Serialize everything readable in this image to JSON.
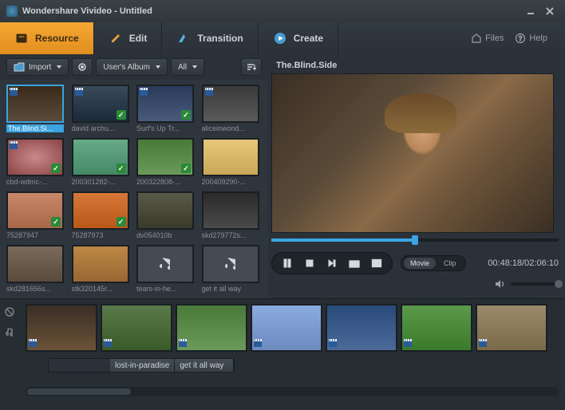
{
  "window": {
    "title": "Wondershare Vivideo - Untitled"
  },
  "tabs": {
    "resource": "Resource",
    "edit": "Edit",
    "transition": "Transition",
    "create": "Create"
  },
  "header_links": {
    "files": "Files",
    "help": "Help"
  },
  "toolbar": {
    "import": "Import",
    "album": "User's Album",
    "filter": "All"
  },
  "thumbs": [
    {
      "label": "The.Blind.Si...",
      "selected": true,
      "video": true,
      "check": false,
      "bg": "bg0"
    },
    {
      "label": "david archu...",
      "selected": false,
      "video": true,
      "check": true,
      "bg": "bg1"
    },
    {
      "label": "Surf's Up Tr...",
      "selected": false,
      "video": true,
      "check": true,
      "bg": "bg2"
    },
    {
      "label": "aliceinwond...",
      "selected": false,
      "video": true,
      "check": false,
      "bg": "bg3"
    },
    {
      "label": "cbd-wdmc-...",
      "selected": false,
      "video": true,
      "check": true,
      "bg": "bg4"
    },
    {
      "label": "200301282-...",
      "selected": false,
      "video": false,
      "check": true,
      "bg": "bg5"
    },
    {
      "label": "200322808-...",
      "selected": false,
      "video": false,
      "check": true,
      "bg": "bg6"
    },
    {
      "label": "200409290-...",
      "selected": false,
      "video": false,
      "check": false,
      "bg": "bg7"
    },
    {
      "label": "75287947",
      "selected": false,
      "video": false,
      "check": true,
      "bg": "bg8"
    },
    {
      "label": "75287973",
      "selected": false,
      "video": false,
      "check": true,
      "bg": "bg9"
    },
    {
      "label": "dv054010b",
      "selected": false,
      "video": false,
      "check": false,
      "bg": "bg10"
    },
    {
      "label": "skd279772s...",
      "selected": false,
      "video": false,
      "check": false,
      "bg": "bg11"
    },
    {
      "label": "skd281656s...",
      "selected": false,
      "video": false,
      "check": false,
      "bg": "bg12"
    },
    {
      "label": "stk320145r...",
      "selected": false,
      "video": false,
      "check": false,
      "bg": "bg13"
    },
    {
      "label": "tears-in-he...",
      "selected": false,
      "audio": true
    },
    {
      "label": "get it all way",
      "selected": false,
      "audio": true
    }
  ],
  "preview": {
    "title": "The.Blind.Side",
    "timecode": "00:48:18/02:06:10",
    "progress_pct": 50
  },
  "mode": {
    "movie": "Movie",
    "clip": "Clip",
    "active": "movie"
  },
  "timeline": {
    "clips": [
      {
        "bg": "tlbg0"
      },
      {
        "bg": "tlbg1"
      },
      {
        "bg": "tlbg2"
      },
      {
        "bg": "tlbg3"
      },
      {
        "bg": "tlbg4"
      },
      {
        "bg": "tlbg5"
      },
      {
        "bg": "tlbg6"
      }
    ],
    "audio": {
      "clip1": "lost-in-paradise",
      "clip2": "get it all way"
    }
  }
}
